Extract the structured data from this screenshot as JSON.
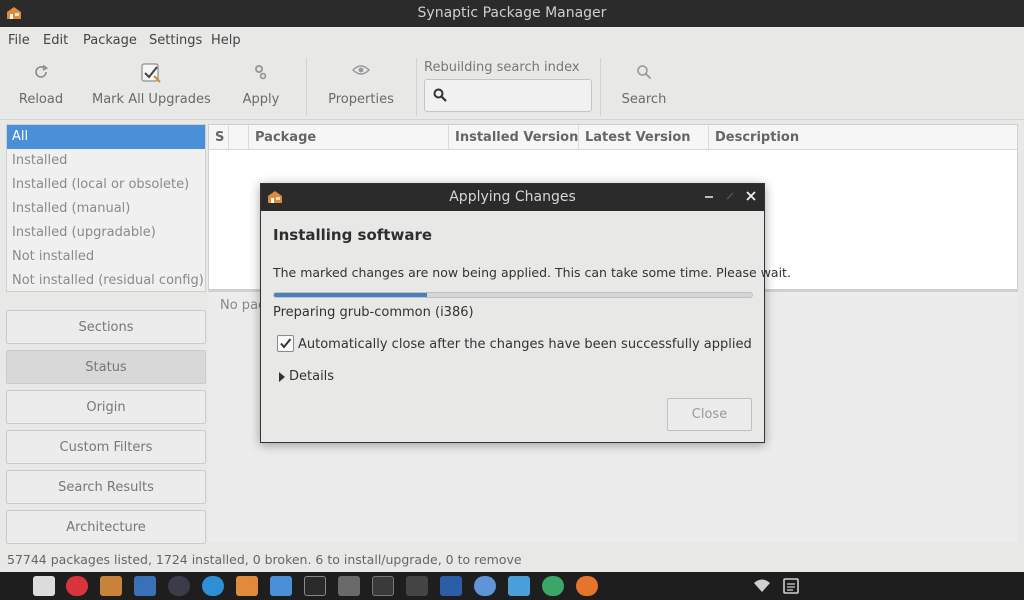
{
  "window": {
    "title": "Synaptic Package Manager"
  },
  "menu": {
    "items": [
      "File",
      "Edit",
      "Package",
      "Settings",
      "Help"
    ]
  },
  "toolbar": {
    "reload": "Reload",
    "mark_all_upgrades": "Mark All Upgrades",
    "apply": "Apply",
    "properties": "Properties",
    "search_caption": "Rebuilding search index",
    "search_value": "",
    "search": "Search"
  },
  "filters": {
    "items": [
      "All",
      "Installed",
      "Installed (local or obsolete)",
      "Installed (manual)",
      "Installed (upgradable)",
      "Not installed",
      "Not installed (residual config)"
    ],
    "selected": "All"
  },
  "side_buttons": [
    "Sections",
    "Status",
    "Origin",
    "Custom Filters",
    "Search Results",
    "Architecture"
  ],
  "table": {
    "columns": [
      "S",
      "",
      "Package",
      "Installed Version",
      "Latest Version",
      "Description"
    ]
  },
  "description_pane": {
    "text": "No pac"
  },
  "statusbar": {
    "text": "57744 packages listed, 1724 installed, 0 broken. 6 to install/upgrade, 0 to remove"
  },
  "dialog": {
    "title": "Applying Changes",
    "heading": "Installing software",
    "message": "The marked changes are now being applied. This can take some time. Please wait.",
    "progress": 0.32,
    "step": "Preparing grub-common (i386)",
    "auto_close_label": "Automatically close after the changes have been successfully applied",
    "auto_close_checked": true,
    "details_label": "Details",
    "close_button": "Close"
  },
  "colors": {
    "selection": "#4a90d9",
    "titlebar": "#2b2b2b",
    "progress": "#4a7fc0"
  },
  "taskbar": {
    "icons": [
      "file-manager-icon",
      "update-icon",
      "archive-icon",
      "yppa-icon",
      "media-player-icon",
      "browser-icon",
      "synaptic-icon",
      "window-icon",
      "system-monitor-icon",
      "mixer-icon",
      "terminal-icon",
      "inkscape-icon",
      "writer-icon",
      "chromium-icon",
      "mail-icon",
      "chrome-icon",
      "firefox-icon"
    ],
    "tray": [
      "wifi-icon",
      "clipboard-icon"
    ]
  }
}
